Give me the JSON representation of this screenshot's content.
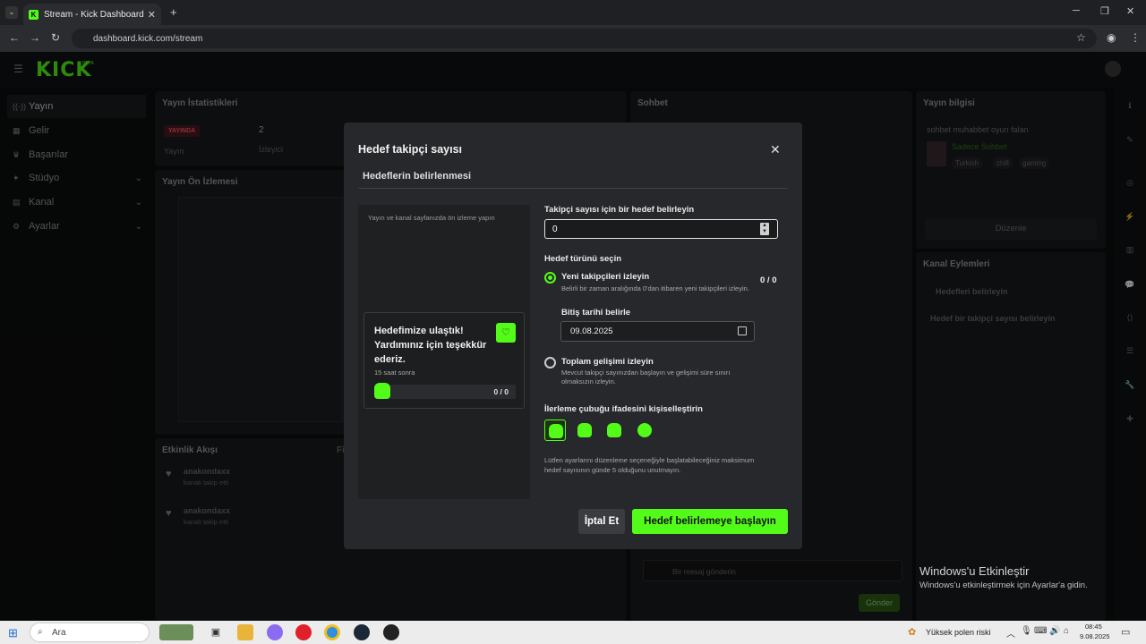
{
  "browser": {
    "tab_title": "Stream - Kick Dashboard",
    "url": "dashboard.kick.com/stream"
  },
  "app": {
    "logo": "KICK",
    "logo_badge": "BETA"
  },
  "sidebar": {
    "items": [
      {
        "label": "Yayın",
        "active": true
      },
      {
        "label": "Gelir"
      },
      {
        "label": "Başarılar"
      },
      {
        "label": "Stüdyo",
        "expandable": true
      },
      {
        "label": "Kanal",
        "expandable": true
      },
      {
        "label": "Ayarlar",
        "expandable": true
      }
    ]
  },
  "panels": {
    "stats_title": "Yayın İstatistikleri",
    "live_badge": "YAYINDA",
    "stream_label": "Yayın",
    "viewer_count": "2",
    "viewer_label": "İzleyici",
    "preview_title": "Yayın Ön İzlemesi",
    "chat_title": "Sohbet",
    "activity_title": "Etkinlik Akışı",
    "activity_filter": "Fi",
    "activity": [
      {
        "user": "anakondaxx",
        "event": "kanalı takip etti"
      },
      {
        "user": "anakondaxx",
        "event": "kanalı takip etti"
      }
    ],
    "info_title": "Yayın bilgisi",
    "info_stream_title": "sohbet muhabbet oyun falan",
    "info_category": "Sadece Sohbet",
    "info_tags": [
      "Turkish",
      "chill",
      "gaming"
    ],
    "info_edit": "Düzenle",
    "actions_title": "Kanal Eylemleri",
    "actions_back": "Hedefleri belirleyin",
    "actions_item": "Hedef bir takipçi sayısı belirleyin",
    "chat_placeholder": "Bir mesaj gönderin",
    "chat_send": "Gönder"
  },
  "modal": {
    "title": "Hedef takipçi sayısı",
    "subtitle": "Hedeflerin belirlenmesi",
    "preview_hint": "Yayın ve kanal sayfanızda ön izleme yapın",
    "goal_card": {
      "title": "Hedefimize ulaştık! Yardımınız için teşekkür ederiz.",
      "time": "15 saat sonra",
      "count": "0 / 0"
    },
    "goal_label": "Takipçi sayısı için bir hedef belirleyin",
    "goal_value": "0",
    "type_label": "Hedef türünü seçin",
    "option1": {
      "label": "Yeni takipçileri izleyin",
      "desc": "Belirli bir zaman aralığında 0'dan itibaren yeni takipçileri izleyin.",
      "count": "0 / 0",
      "selected": true
    },
    "end_date_label": "Bitiş tarihi belirle",
    "end_date_value": "09.08.2025",
    "option2": {
      "label": "Toplam gelişimi izleyin",
      "desc": "Mevcut takipçi sayınızdan başlayın ve gelişimi süre sınırı olmaksızın izleyin.",
      "selected": false
    },
    "emote_label": "İlerleme çubuğu ifadesini kişiselleştirin",
    "note": "Lütfen ayarlarını düzenleme seçeneğiyle başlatabileceğiniz maksimum hedef sayısının günde 5 olduğunu unutmayın.",
    "cancel": "İptal Et",
    "start": "Hedef belirlemeye başlayın"
  },
  "windows": {
    "activate_title": "Windows'u Etkinleştir",
    "activate_desc": "Windows'u etkinleştirmek için Ayarlar'a gidin.",
    "search": "Ara",
    "weather": "Yüksek polen riski",
    "time": "08:45",
    "date": "9.08.2025"
  },
  "colors": {
    "accent": "#53fc18",
    "modal_bg": "#26282b",
    "page_bg": "#0c0d0e"
  }
}
